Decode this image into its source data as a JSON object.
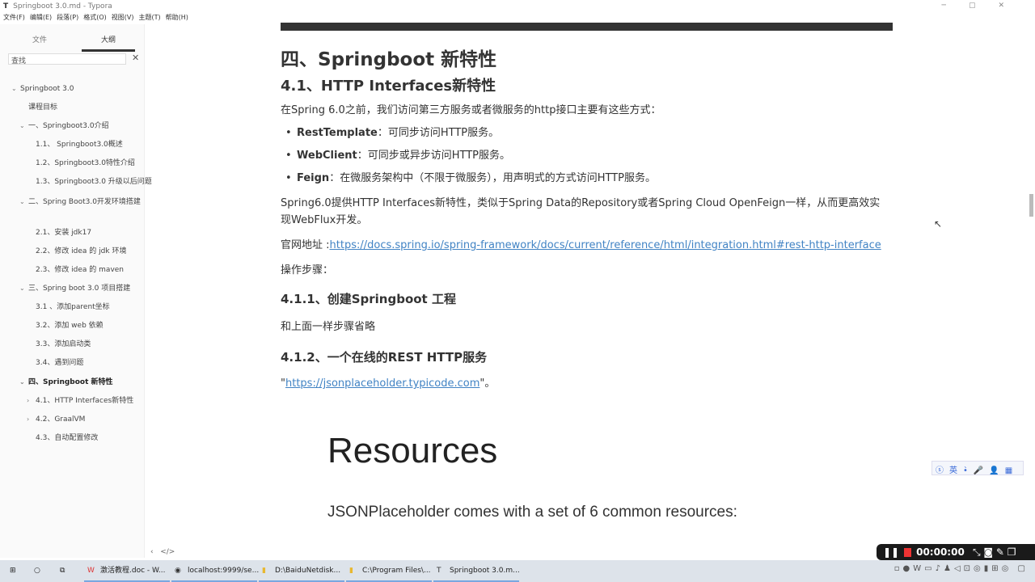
{
  "window": {
    "title": "Springboot 3.0.md - Typora",
    "app_icon": "T",
    "controls": [
      "─",
      "▢",
      "✕"
    ]
  },
  "menu": [
    "文件(F)",
    "编辑(E)",
    "段落(P)",
    "格式(O)",
    "视图(V)",
    "主题(T)",
    "帮助(H)"
  ],
  "sidebar": {
    "tabs": [
      "文件",
      "大纲"
    ],
    "search_placeholder": "查找",
    "outline": [
      {
        "label": "Springboot 3.0",
        "level": 0,
        "chev": "⌄"
      },
      {
        "label": "课程目标",
        "level": 1
      },
      {
        "label": "一、Springboot3.0介绍",
        "level": 1,
        "chev": "⌄"
      },
      {
        "label": "1.1、 Springboot3.0概述",
        "level": 2
      },
      {
        "label": "1.2、Springboot3.0特性介绍",
        "level": 2
      },
      {
        "label": "1.3、Springboot3.0 升级以后问题",
        "level": 2
      },
      {
        "label": "二、Spring Boot3.0开发环境搭建",
        "level": 1,
        "chev": "⌄"
      },
      {
        "label": "2.1、安装 jdk17",
        "level": 2
      },
      {
        "label": "2.2、修改 idea 的 jdk 环境",
        "level": 2
      },
      {
        "label": "2.3、修改 idea 的 maven",
        "level": 2
      },
      {
        "label": "三、Spring boot 3.0 项目搭建",
        "level": 1,
        "chev": "⌄"
      },
      {
        "label": "3.1 、添加parent坐标",
        "level": 2
      },
      {
        "label": "3.2、添加 web 依赖",
        "level": 2
      },
      {
        "label": "3.3、添加启动类",
        "level": 2
      },
      {
        "label": "3.4、遇到问题",
        "level": 2
      },
      {
        "label": "四、Springboot 新特性",
        "level": 1,
        "chev": "⌄",
        "bold": true
      },
      {
        "label": "4.1、HTTP Interfaces新特性",
        "level": 2,
        "chev": "›"
      },
      {
        "label": "4.2、GraalVM",
        "level": 2,
        "chev": "›"
      },
      {
        "label": "4.3、自动配置修改",
        "level": 2
      }
    ]
  },
  "doc": {
    "h1": "四、Springboot 新特性",
    "h2": "4.1、HTTP Interfaces新特性",
    "p1": "在Spring 6.0之前，我们访问第三方服务或者微服务的http接口主要有这些方式：",
    "bullets": [
      {
        "b": "RestTemplate",
        "t": "：可同步访问HTTP服务。"
      },
      {
        "b": "WebClient",
        "t": "：可同步或异步访问HTTP服务。"
      },
      {
        "b": "Feign",
        "t": "：在微服务架构中（不限于微服务），用声明式的方式访问HTTP服务。"
      }
    ],
    "p2": "Spring6.0提供HTTP Interfaces新特性，类似于Spring Data的Repository或者Spring Cloud OpenFeign一样，从而更高效实现WebFlux开发。",
    "p3_prefix": "官网地址 :",
    "p3_link": "https://docs.spring.io/spring-framework/docs/current/reference/html/integration.html#rest-http-interface",
    "p4": "操作步骤：",
    "h3a": "4.1.1、创建Springboot 工程",
    "p5": "和上面一样步骤省略",
    "h3b": "4.1.2、一个在线的REST HTTP服务",
    "p6_link": "https://jsonplaceholder.typicode.com",
    "p6_q1": "\"",
    "p6_q2": "\"。",
    "img_title": "Resources",
    "img_sub": "JSONPlaceholder comes with a set of 6 common resources:"
  },
  "ime": "ⓢ英•̀🎤👤▦",
  "recorder": {
    "time": "00:00:00"
  },
  "taskbar": {
    "apps": [
      "激活教程.doc - W...",
      "localhost:9999/se...",
      "D:\\BaiduNetdisk...",
      "C:\\Program Files\\...",
      "Springboot 3.0.m..."
    ]
  }
}
